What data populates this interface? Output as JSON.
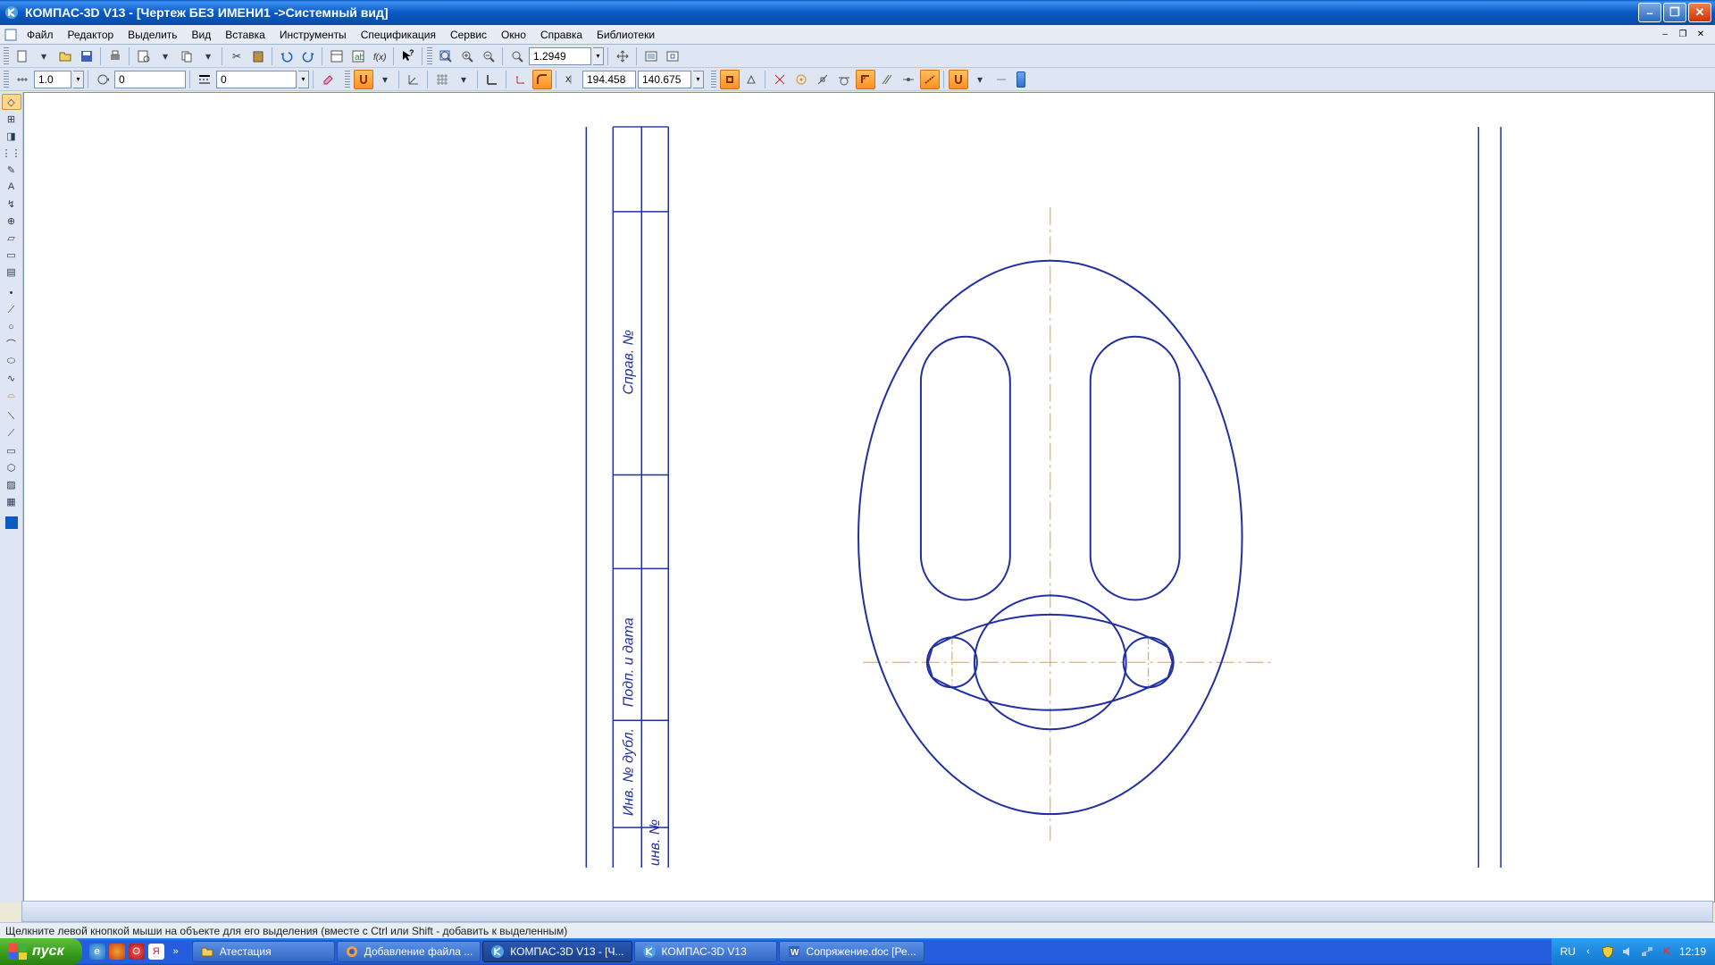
{
  "title": "КОМПАС-3D V13 - [Чертеж БЕЗ ИМЕНИ1 ->Системный вид]",
  "menus": {
    "file": "Файл",
    "edit": "Редактор",
    "select": "Выделить",
    "view": "Вид",
    "insert": "Вставка",
    "tools": "Инструменты",
    "spec": "Спецификация",
    "service": "Сервис",
    "window": "Окно",
    "help": "Справка",
    "libraries": "Библиотеки"
  },
  "toolbar1": {
    "zoom": "1.2949",
    "coord_x": "194.458",
    "coord_y": "140.675"
  },
  "toolbar2": {
    "step": "1.0",
    "rotation": "0",
    "angle": "0"
  },
  "statusbar": {
    "hint": "Щелкните левой кнопкой мыши на объекте для его выделения (вместе с Ctrl или Shift - добавить к выделенным)"
  },
  "taskbar": {
    "start": "пуск",
    "tasks": [
      {
        "label": "Атестация",
        "active": false,
        "icon": "folder"
      },
      {
        "label": "Добавление файла ...",
        "active": false,
        "icon": "browser"
      },
      {
        "label": "КОМПАС-3D V13 - [Ч...",
        "active": true,
        "icon": "kompas"
      },
      {
        "label": "КОМПАС-3D V13",
        "active": false,
        "icon": "kompas"
      },
      {
        "label": "Сопряжение.doc [Ре...",
        "active": false,
        "icon": "word"
      }
    ],
    "lang": "RU",
    "clock": "12:19"
  },
  "ltool_icons": [
    "⬚",
    "⊞",
    "⬛",
    "⋮⋮",
    "▭",
    "A",
    "✎",
    "⊕",
    "▱",
    "⬜",
    "▤",
    "",
    "○",
    "⊙",
    "⌒",
    "⌓",
    "⌇",
    "",
    "⟋",
    "⟍",
    "⊡",
    "⬚",
    "⋯",
    "▦",
    "▧"
  ]
}
